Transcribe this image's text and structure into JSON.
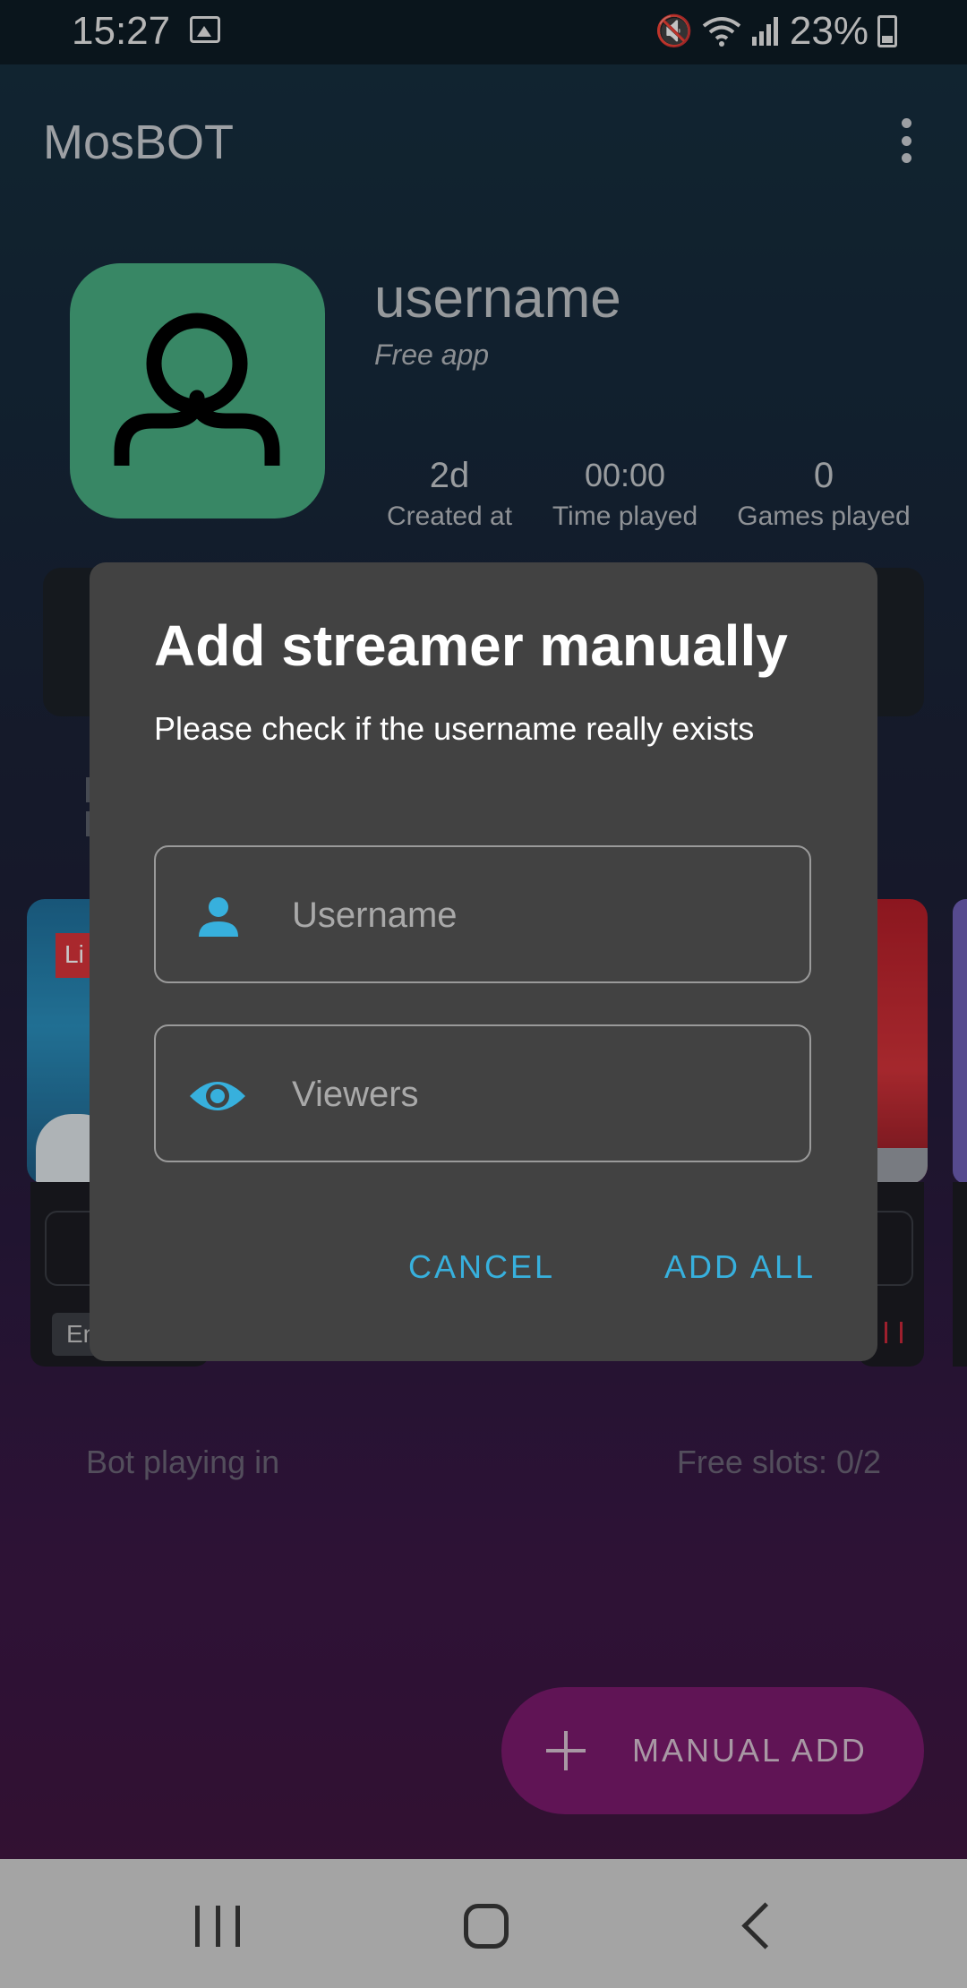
{
  "status_bar": {
    "time": "15:27",
    "battery": "23%",
    "icons": [
      "image-icon",
      "mute-icon",
      "wifi-icon",
      "signal-icon",
      "battery-icon"
    ]
  },
  "app_bar": {
    "title": "MosBOT",
    "menu_icon": "more-vert-icon"
  },
  "profile": {
    "name": "username",
    "subtitle": "Free app",
    "stats": [
      {
        "value": "2d",
        "label": "Created at"
      },
      {
        "value": "00:00",
        "label": "Time played"
      },
      {
        "value": "0",
        "label": "Games played"
      }
    ]
  },
  "background": {
    "live_badge": "Li",
    "chip_text": "En",
    "playing_label": "Bot playing in",
    "slots_label": "Free slots: 0/2"
  },
  "fab": {
    "label": "MANUAL ADD",
    "icon": "plus-icon"
  },
  "dialog": {
    "title": "Add streamer manually",
    "message": "Please check if the username really exists",
    "fields": {
      "username": {
        "placeholder": "Username",
        "value": "",
        "icon": "person-icon"
      },
      "viewers": {
        "placeholder": "Viewers",
        "value": "",
        "icon": "eye-icon"
      }
    },
    "cancel_label": "CANCEL",
    "confirm_label": "ADD ALL"
  },
  "colors": {
    "accent": "#37b0dd",
    "dialog_bg": "#424242",
    "avatar_bg": "#48ad82",
    "fab_bg": "#7b1a6e"
  }
}
